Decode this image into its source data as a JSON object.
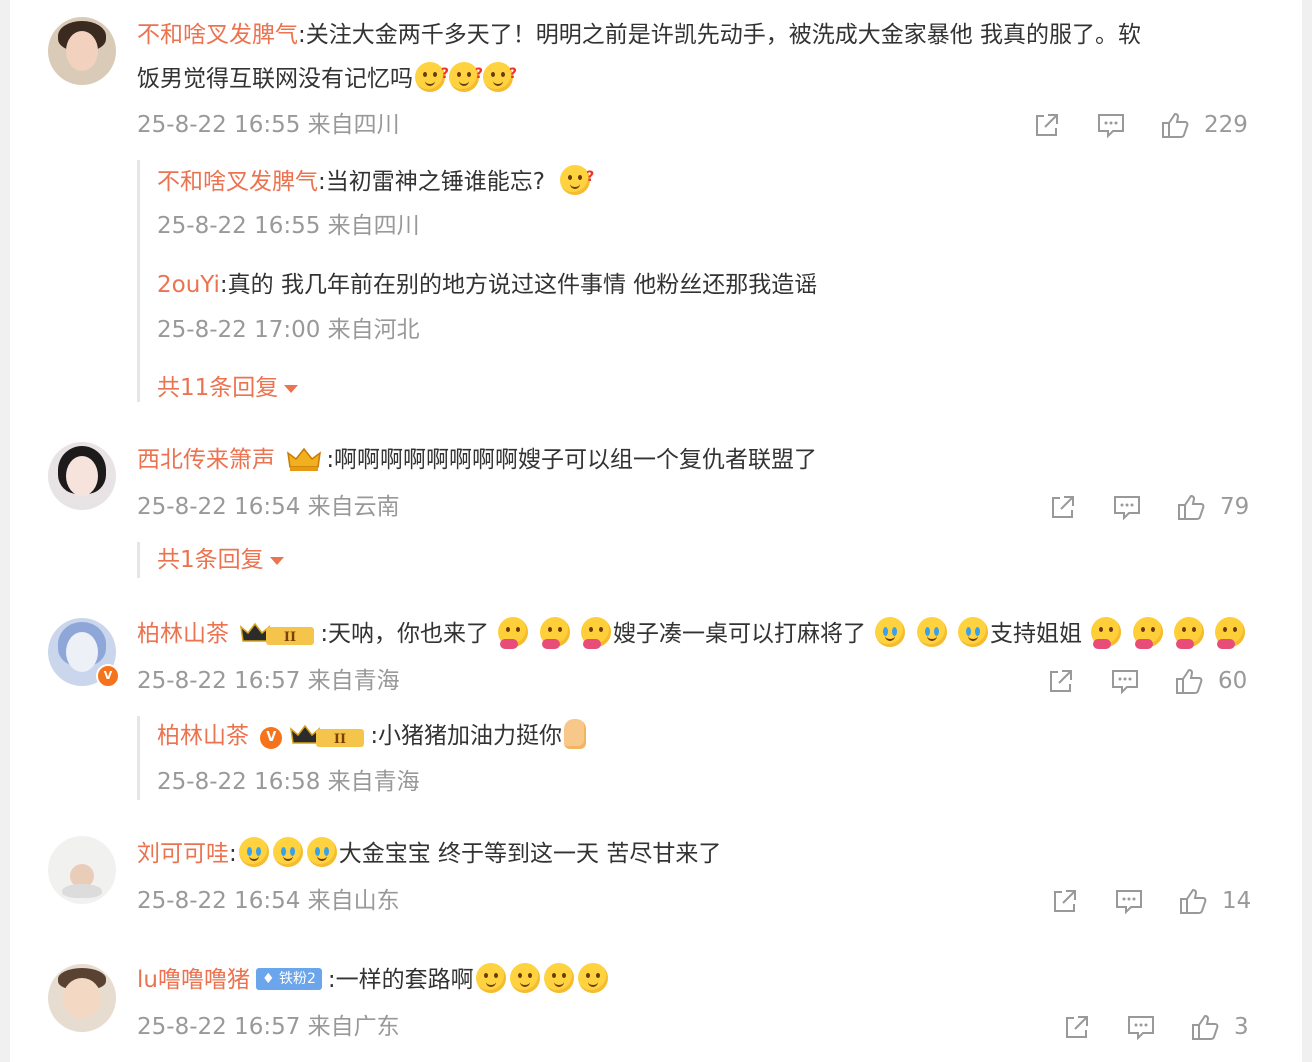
{
  "comments": [
    {
      "username": "不和啥叉发脾气",
      "text_line1": ":关注大金两千多天了！明明之前是许凯先动手，被洗成大金家暴他 我真的服了。软",
      "text_line2": "饭男觉得互联网没有记忆吗",
      "emojis": [
        "thinking-emoji",
        "thinking-emoji",
        "thinking-emoji"
      ],
      "timestamp": "25-8-22 16:55 来自四川",
      "likes": "229",
      "replies": [
        {
          "username": "不和啥叉发脾气",
          "text": ":当初雷神之锤谁能忘?",
          "emojis": [
            "thinking-emoji"
          ],
          "timestamp": "25-8-22 16:55 来自四川"
        },
        {
          "username": "2ouYi",
          "text": ":真的 我几年前在别的地方说过这件事情 他粉丝还那我造谣",
          "timestamp": "25-8-22 17:00 来自河北"
        }
      ],
      "more_replies": "共11条回复"
    },
    {
      "username": "西北传来箫声",
      "text": ":啊啊啊啊啊啊啊啊嫂子可以组一个复仇者联盟了",
      "timestamp": "25-8-22 16:54 来自云南",
      "likes": "79",
      "more_replies": "共1条回复"
    },
    {
      "username": "柏林山茶",
      "badge": "II",
      "text_a": ":天呐，你也来了",
      "text_b": "嫂子凑一桌可以打麻将了",
      "text_c": "支持姐姐",
      "timestamp": "25-8-22 16:57 来自青海",
      "likes": "60",
      "replies": [
        {
          "username": "柏林山茶",
          "badge": "II",
          "text": ":小猪猪加油力挺你",
          "timestamp": "25-8-22 16:58 来自青海"
        }
      ]
    },
    {
      "username": "刘可可哇",
      "text": "大金宝宝 终于等到这一天 苦尽甘来了",
      "prefix": ":",
      "timestamp": "25-8-22 16:54 来自山东",
      "likes": "14"
    },
    {
      "username": "lu噜噜噜猪",
      "fan_badge": "铁粉2",
      "text": ":一样的套路啊",
      "timestamp": "25-8-22 16:57 来自广东",
      "likes": "3"
    }
  ],
  "icons": {
    "share": "share-icon",
    "comment": "comment-icon",
    "like": "like-icon",
    "vip": "vip-crown-icon",
    "verified": "verified-icon"
  },
  "colors": {
    "username": "#eb7350",
    "meta": "#999999",
    "text": "#333333",
    "fan_badge": "#6ba5ec"
  }
}
